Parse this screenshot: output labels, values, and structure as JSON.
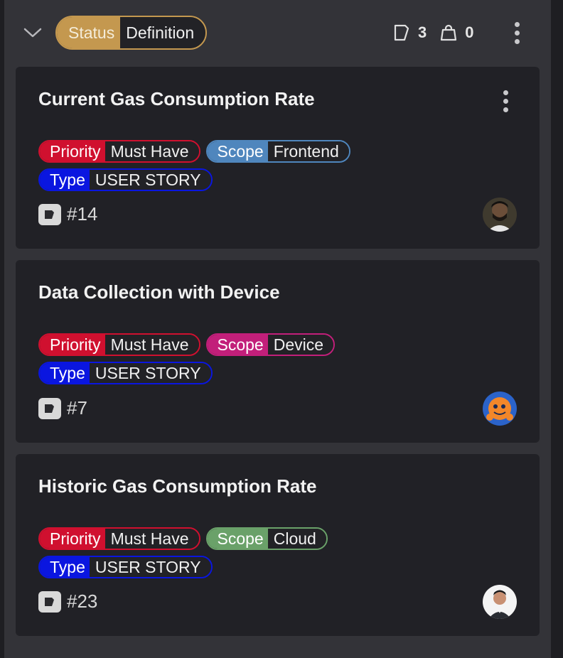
{
  "column": {
    "status_key": "Status",
    "status_value": "Definition",
    "story_count": "3",
    "task_count": "0",
    "colors": {
      "status": "#c4984f"
    }
  },
  "cards": [
    {
      "title": "Current Gas Consumption Rate",
      "tags": [
        {
          "key": "Priority",
          "value": "Must Have",
          "color": "#d0102f"
        },
        {
          "key": "Scope",
          "value": "Frontend",
          "color": "#4f86bd"
        },
        {
          "key": "Type",
          "value": "USER STORY",
          "color": "#0a16e0"
        }
      ],
      "ref": "#14",
      "avatar": "avatar-bearded-man"
    },
    {
      "title": "Data Collection with Device",
      "tags": [
        {
          "key": "Priority",
          "value": "Must Have",
          "color": "#d0102f"
        },
        {
          "key": "Scope",
          "value": "Device",
          "color": "#c21f7a"
        },
        {
          "key": "Type",
          "value": "USER STORY",
          "color": "#0a16e0"
        }
      ],
      "ref": "#7",
      "avatar": "avatar-orange-cartoon"
    },
    {
      "title": "Historic Gas Consumption Rate",
      "tags": [
        {
          "key": "Priority",
          "value": "Must Have",
          "color": "#d0102f"
        },
        {
          "key": "Scope",
          "value": "Cloud",
          "color": "#6aa169"
        },
        {
          "key": "Type",
          "value": "USER STORY",
          "color": "#0a16e0"
        }
      ],
      "ref": "#23",
      "avatar": "avatar-man-white-bg"
    }
  ]
}
